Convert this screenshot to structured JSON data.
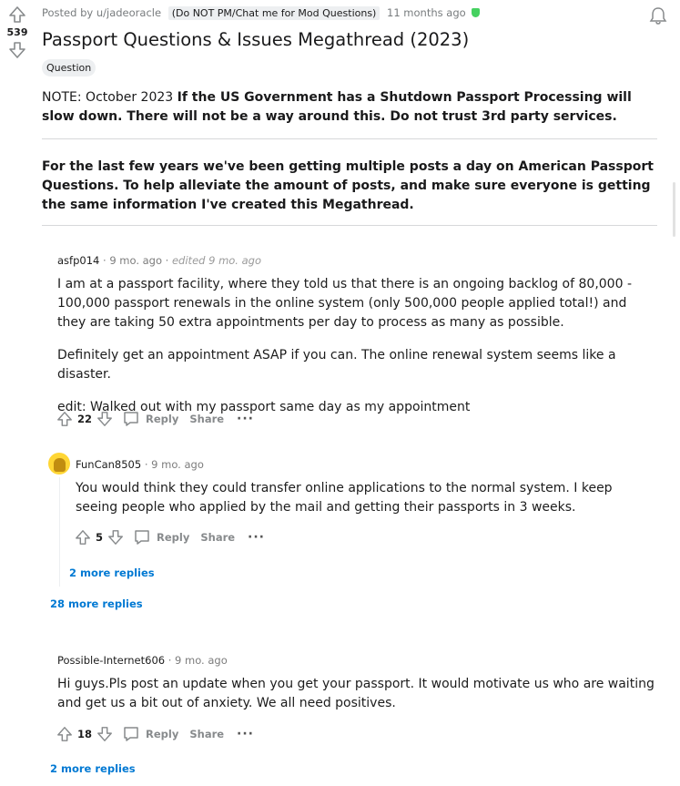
{
  "post": {
    "score": "539",
    "meta_prefix": "Posted by u/jadeoracle",
    "meta_flair": "(Do NOT PM/Chat me for Mod Questions)",
    "meta_time": "11 months ago",
    "title": "Passport Questions & Issues Megathread (2023)",
    "flair": "Question",
    "note_prefix": "NOTE: October 2023 ",
    "note_bold": "If the US Government has a Shutdown Passport Processing will slow down. There will not be a way around this. Do not trust 3rd party services.",
    "intro": "For the last few years we've been getting multiple posts a day on American Passport Questions. To help alleviate the amount of posts, and make sure everyone is getting the same information I've created this Megathread."
  },
  "comments": [
    {
      "user": "asfp014",
      "time": "9 mo. ago",
      "edited": "edited 9 mo. ago",
      "paragraphs": [
        "I am at a passport facility, where they told us that there is an ongoing backlog of 80,000 - 100,000 passport renewals in the online system (only 500,000 people applied total!) and they are taking 50 extra appointments per day to process as many as possible.",
        "Definitely get an appointment ASAP if you can. The online renewal system seems like a disaster.",
        "edit: Walked out with my passport same day as my appointment"
      ],
      "votes": "22",
      "reply_label": "Reply",
      "share_label": "Share",
      "more_label": "···"
    },
    {
      "user": "FunCan8505",
      "time": "9 mo. ago",
      "text": "You would think they could transfer online applications to the normal system. I keep seeing people who applied by the mail and getting their passports in 3 weeks.",
      "votes": "5",
      "reply_label": "Reply",
      "share_label": "Share",
      "more_label": "···",
      "more_replies": "2 more replies"
    },
    {
      "user": "Possible-Internet606",
      "time": "9 mo. ago",
      "text": "Hi guys.Pls post an update when you get your passport. It would motivate us who are waiting and get us a bit out of anxiety. We all need positives.",
      "votes": "18",
      "reply_label": "Reply",
      "share_label": "Share",
      "more_label": "···"
    }
  ],
  "thread_more_replies": "28 more replies",
  "bottom_more_replies": "2 more replies",
  "colors": {
    "link": "#0079d3",
    "mod_shield": "#46d160",
    "meta": "#787c7e"
  }
}
